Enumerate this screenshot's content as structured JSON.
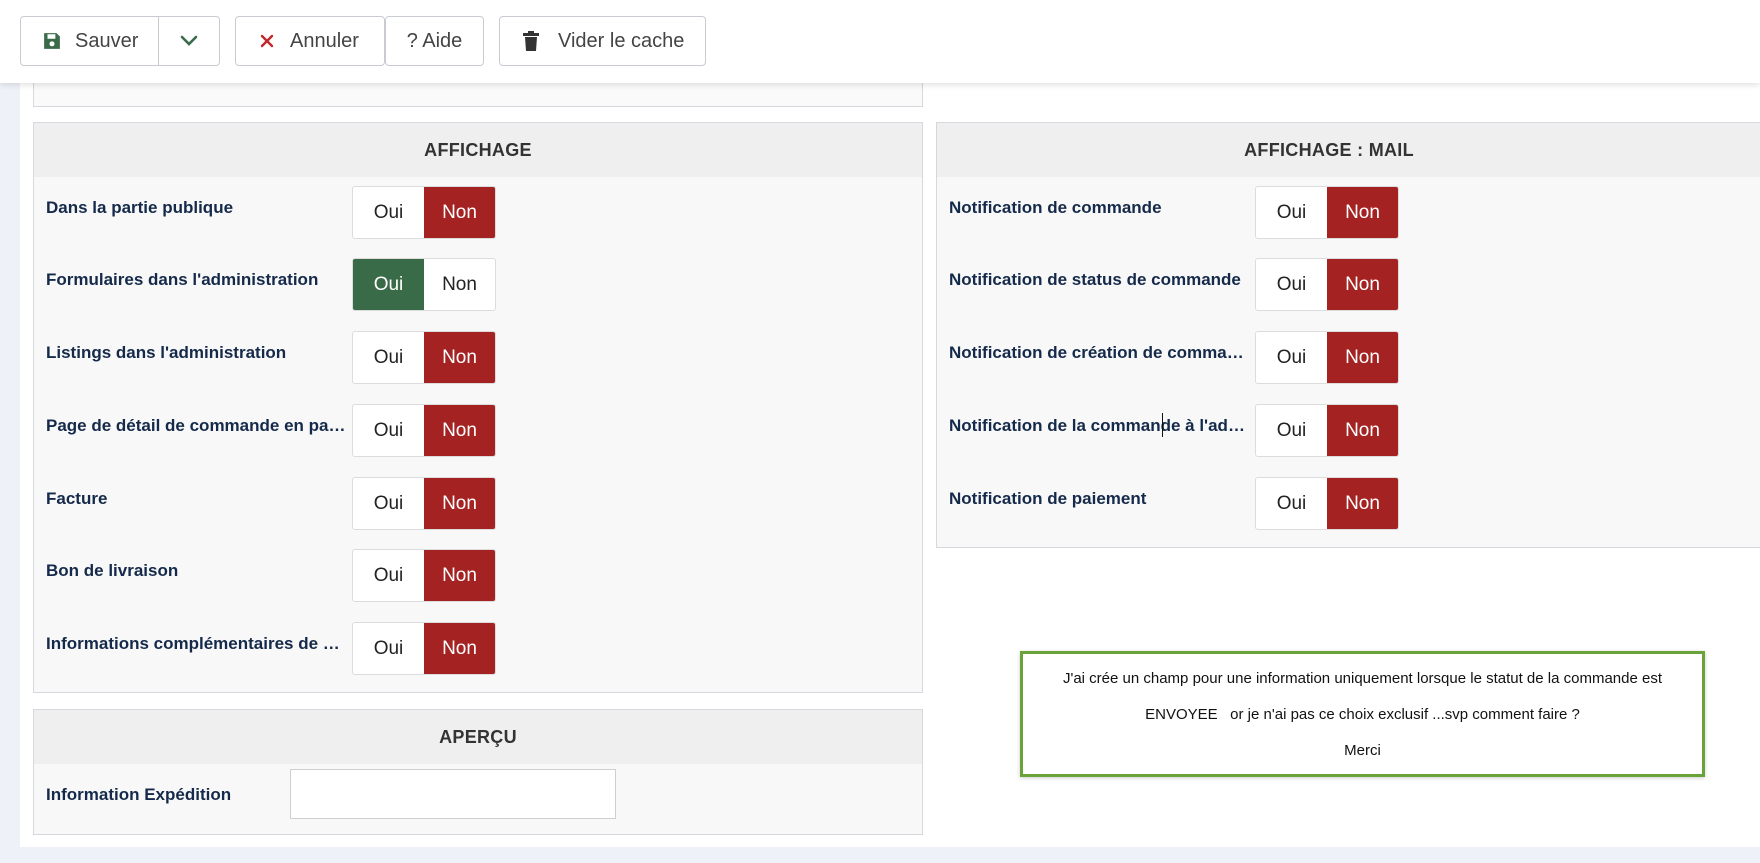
{
  "toolbar": {
    "save_label": "Sauver",
    "cancel_label": "Annuler",
    "help_label": "? Aide",
    "clear_cache_label": "Vider le cache"
  },
  "colors": {
    "oui_active": "#3a6b48",
    "non_active": "#a52222",
    "note_border": "#6aa33a",
    "save_icon": "#3a6b48",
    "cancel_icon": "#c0272d"
  },
  "toggle_labels": {
    "yes": "Oui",
    "no": "Non"
  },
  "affichage": {
    "title": "AFFICHAGE",
    "rows": [
      {
        "label": "Dans la partie publique",
        "value": "Non"
      },
      {
        "label": "Formulaires dans l'administration",
        "value": "Oui"
      },
      {
        "label": "Listings dans l'administration",
        "value": "Non"
      },
      {
        "label": "Page de détail de commande en partie publique",
        "value": "Non"
      },
      {
        "label": "Facture",
        "value": "Non"
      },
      {
        "label": "Bon de livraison",
        "value": "Non"
      },
      {
        "label": "Informations complémentaires de commande",
        "value": "Non"
      }
    ]
  },
  "affichage_mail": {
    "title": "AFFICHAGE : MAIL",
    "rows": [
      {
        "label": "Notification de commande",
        "value": "Non"
      },
      {
        "label": "Notification de status de commande",
        "value": "Non"
      },
      {
        "label": "Notification de création de commande",
        "value": "Non"
      },
      {
        "label": "Notification de la commande à l'administrateur",
        "value": "Non"
      },
      {
        "label": "Notification de paiement",
        "value": "Non"
      }
    ]
  },
  "apercu": {
    "title": "APERÇU",
    "field_label": "Information Expédition",
    "field_value": ""
  },
  "note": {
    "line1": "J'ai crée un champ pour une information uniquement lorsque le statut de la commande est",
    "line2": "ENVOYEE   or je n'ai pas ce choix exclusif ...svp comment faire ?",
    "line3": "Merci"
  }
}
